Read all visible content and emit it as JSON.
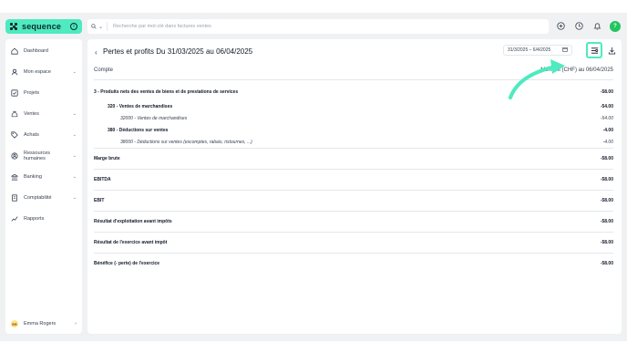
{
  "brand": {
    "name": "sequence",
    "color": "#4eeac0"
  },
  "search": {
    "placeholder": "Recherche par mot-clé dans factures ventes"
  },
  "topbar": {
    "icons": [
      "plus-circle-icon",
      "clock-icon",
      "bell-icon",
      "help-icon"
    ],
    "help_label": "?"
  },
  "sidebar": {
    "items": [
      {
        "label": "Dashboard",
        "icon": "home-icon",
        "chevron": false
      },
      {
        "label": "Mon espace",
        "icon": "user-icon",
        "chevron": true
      },
      {
        "label": "Projets",
        "icon": "check-square-icon",
        "chevron": false
      },
      {
        "label": "Ventes",
        "icon": "money-bag-icon",
        "chevron": true
      },
      {
        "label": "Achats",
        "icon": "tag-icon",
        "chevron": true
      },
      {
        "label": "Ressources humaines",
        "icon": "users-icon",
        "chevron": true
      },
      {
        "label": "Banking",
        "icon": "bank-icon",
        "chevron": true
      },
      {
        "label": "Comptabilité",
        "icon": "ledger-icon",
        "chevron": true
      },
      {
        "label": "Rapports",
        "icon": "chart-icon",
        "chevron": false
      }
    ],
    "user": {
      "initials": "ER",
      "name": "Emma Rogers"
    }
  },
  "page": {
    "title": "Pertes et profits Du 31/03/2025 au 06/04/2025",
    "date_range": "31/3/2025 – 6/4/2025",
    "col_account": "Compte",
    "col_amount": "Montant (CHF) au 06/04/2025"
  },
  "rows": [
    {
      "type": "sec",
      "label": "3 - Produits nets des ventes de biens et de prestations de services",
      "amount": "-58.00"
    },
    {
      "type": "sub",
      "label": "320 - Ventes de marchandises",
      "amount": "-54.00"
    },
    {
      "type": "det",
      "label": "32000 - Ventes de marchandises",
      "amount": "-54.00"
    },
    {
      "type": "sub",
      "label": "380 - Déductions sur ventes",
      "amount": "-4.00"
    },
    {
      "type": "det",
      "label": "38000 - Déductions sur ventes (escomptes, rabais, ristournes, ...)",
      "amount": "-4.00"
    },
    {
      "type": "tot",
      "label": "Marge brute",
      "amount": "-58.00"
    },
    {
      "type": "tot",
      "label": "EBITDA",
      "amount": "-58.00"
    },
    {
      "type": "tot",
      "label": "EBIT",
      "amount": "-58.00"
    },
    {
      "type": "tot",
      "label": "Résultat d'exploitation avant impôts",
      "amount": "-58.00"
    },
    {
      "type": "tot",
      "label": "Résultat de l'exercice avant impôt",
      "amount": "-58.00"
    },
    {
      "type": "tot",
      "label": "Bénéfice (- perte) de l'exercice",
      "amount": "-58.00"
    }
  ]
}
